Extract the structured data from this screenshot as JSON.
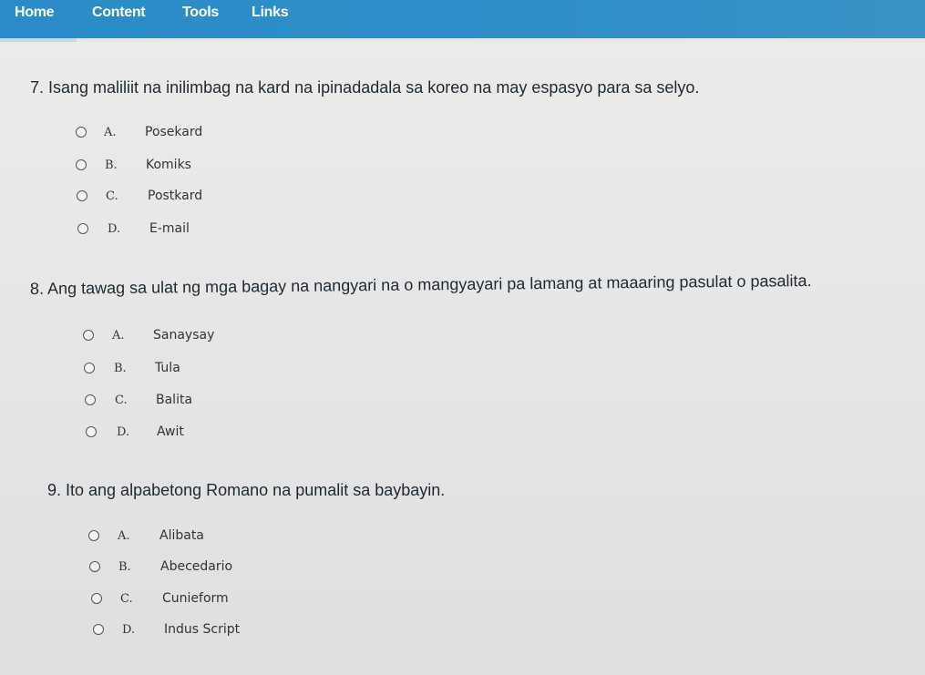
{
  "nav": {
    "items": [
      {
        "label": "Home"
      },
      {
        "label": "Content"
      },
      {
        "label": "Tools"
      },
      {
        "label": "Links"
      }
    ]
  },
  "questions": [
    {
      "text": "7. Isang maliliit na inilimbag na kard na ipinadadala sa koreo na may espasyo para sa selyo.",
      "options": [
        {
          "letter": "A.",
          "text": "Posekard"
        },
        {
          "letter": "B.",
          "text": "Komiks"
        },
        {
          "letter": "C.",
          "text": "Postkard"
        },
        {
          "letter": "D.",
          "text": "E-mail"
        }
      ]
    },
    {
      "text": "8. Ang tawag sa ulat ng mga bagay na nangyari na o mangyayari pa lamang at maaaring pasulat o pasalita.",
      "options": [
        {
          "letter": "A.",
          "text": "Sanaysay"
        },
        {
          "letter": "B.",
          "text": "Tula"
        },
        {
          "letter": "C.",
          "text": "Balita"
        },
        {
          "letter": "D.",
          "text": "Awit"
        }
      ]
    },
    {
      "text": "9. Ito ang alpabetong Romano na pumalit sa baybayin.",
      "options": [
        {
          "letter": "A.",
          "text": "Alibata"
        },
        {
          "letter": "B.",
          "text": "Abecedario"
        },
        {
          "letter": "C.",
          "text": "Cunieform"
        },
        {
          "letter": "D.",
          "text": "Indus Script"
        }
      ]
    }
  ]
}
